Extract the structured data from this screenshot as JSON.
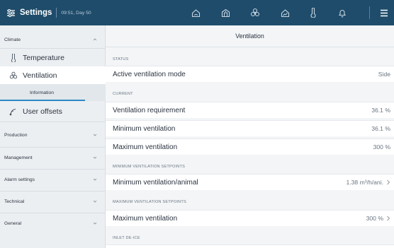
{
  "topbar": {
    "title": "Settings",
    "time": "09:51, Day 50",
    "icons": [
      "house-icon",
      "barn-icon",
      "fan-icon",
      "chart-icon",
      "thermometer-icon",
      "bell-icon",
      "menu-icon"
    ],
    "bg_color": "#1f4c6b"
  },
  "sidebar": {
    "groups": {
      "climate": "Climate",
      "production": "Production",
      "management": "Management",
      "alarm_settings": "Alarm settings",
      "technical": "Technical",
      "general": "General"
    },
    "items": {
      "temperature": "Temperature",
      "ventilation": "Ventilation",
      "information": "Information",
      "user_offsets": "User offsets"
    },
    "accent_color": "#2f88c4"
  },
  "main": {
    "title": "Ventilation",
    "sections": {
      "status": "STATUS",
      "current": "CURRENT",
      "min_setpoints": "MINIMUM VENTILATION SETPOINTS",
      "max_setpoints": "MAXIMUM VENTILATION SETPOINTS",
      "inlet_deice": "INLET DE-ICE"
    },
    "rows": {
      "active_mode": {
        "label": "Active ventilation mode",
        "value": "Side"
      },
      "requirement": {
        "label": "Ventilation requirement",
        "value": "36.1 %"
      },
      "minimum": {
        "label": "Minimum ventilation",
        "value": "36.1 %"
      },
      "maximum": {
        "label": "Maximum ventilation",
        "value": "300 %"
      },
      "min_per_animal": {
        "label": "Minimum ventilation/animal",
        "value": "1.38 m³/h/ani."
      },
      "max_setpoint": {
        "label": "Maximum ventilation",
        "value": "300 %"
      }
    }
  }
}
